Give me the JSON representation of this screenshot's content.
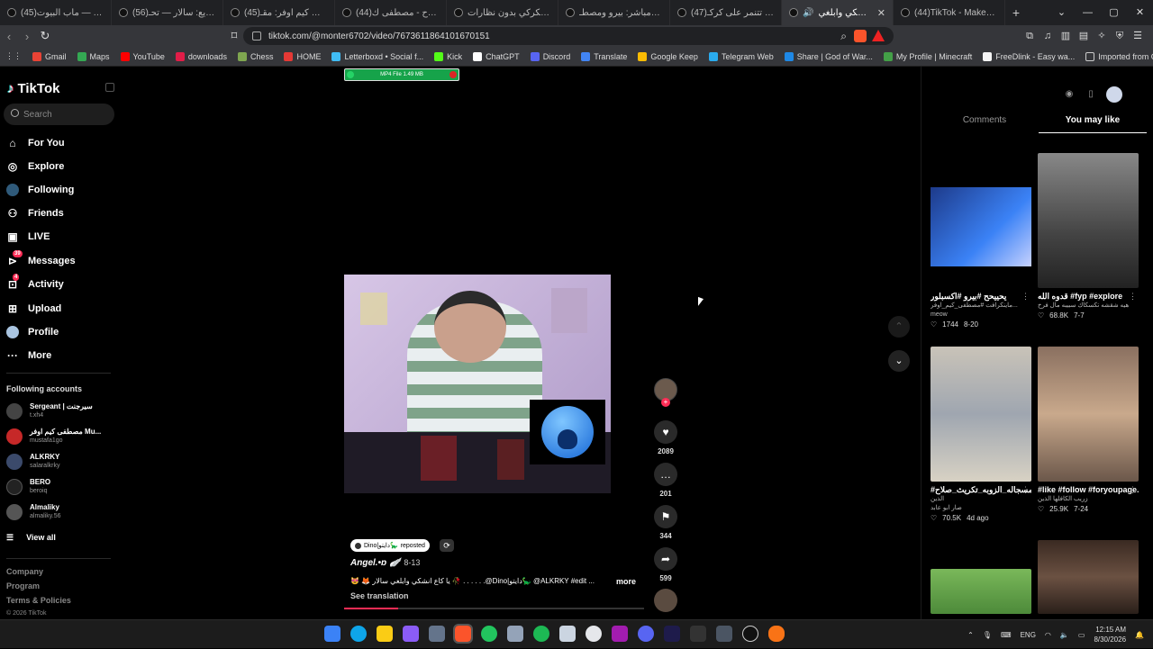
{
  "browser": {
    "tabs": [
      {
        "title": "(45)نص قلب — ماب البيوت"
      },
      {
        "title": "(56)كور سريع: سالار — تحـ"
      },
      {
        "title": "(45)مصطفى كيم اوفر: مقـ"
      },
      {
        "title": "(44)بحث ارتاح - مصطفى ك"
      },
      {
        "title": "سالار الكركي بدون نظارات"
      },
      {
        "title": "بث بيرو مباشر: بيرو ومصطـ"
      },
      {
        "title": "(47)ديرياتك تتنمر على كركـ"
      },
      {
        "title": "يا كاع انشكي وابلغي",
        "active": true
      },
      {
        "title": "(44)TikTok - Make Your D"
      }
    ],
    "new_tab": "+",
    "window_controls": {
      "minimize": "—",
      "maximize": "▢",
      "close": "✕",
      "chevron": "⌄"
    },
    "url": "tiktok.com/@monter6702/video/7673611864101670151",
    "bookmarks": [
      {
        "label": "Gmail",
        "color": "#ea4335"
      },
      {
        "label": "Maps",
        "color": "#34a853"
      },
      {
        "label": "YouTube",
        "color": "#ff0000"
      },
      {
        "label": "downloads",
        "color": "#e11d48"
      },
      {
        "label": "Chess",
        "color": "#7fa650"
      },
      {
        "label": "HOME",
        "color": "#e53935"
      },
      {
        "label": "Letterboxd • Social f...",
        "color": "#40bcf4"
      },
      {
        "label": "Kick",
        "color": "#53fc18"
      },
      {
        "label": "ChatGPT",
        "color": "#ffffff"
      },
      {
        "label": "Discord",
        "color": "#5865f2"
      },
      {
        "label": "Translate",
        "color": "#4285f4"
      },
      {
        "label": "Google Keep",
        "color": "#fbbc04"
      },
      {
        "label": "Telegram Web",
        "color": "#2aabee"
      },
      {
        "label": "Share | God of War...",
        "color": "#1e88e5"
      },
      {
        "label": "My Profile | Minecraft",
        "color": "#43a047"
      },
      {
        "label": "FreeDlink - Easy wa...",
        "color": "#f5f5f5"
      }
    ],
    "bookmarks_folder": "Imported from Go..."
  },
  "tiktok": {
    "logo": "TikTok",
    "search_placeholder": "Search",
    "nav": [
      {
        "label": "For You",
        "icon": "home-icon"
      },
      {
        "label": "Explore",
        "icon": "compass-icon"
      },
      {
        "label": "Following",
        "icon": "following-icon"
      },
      {
        "label": "Friends",
        "icon": "friends-icon"
      },
      {
        "label": "LIVE",
        "icon": "live-icon"
      },
      {
        "label": "Messages",
        "icon": "messages-icon",
        "badge": "39"
      },
      {
        "label": "Activity",
        "icon": "activity-icon",
        "badge": "4"
      },
      {
        "label": "Upload",
        "icon": "upload-icon"
      },
      {
        "label": "Profile",
        "icon": "profile-icon"
      },
      {
        "label": "More",
        "icon": "more-icon"
      }
    ],
    "following_heading": "Following accounts",
    "following": [
      {
        "name": "Sergeant | سيرجنت",
        "handle": "t.xh4"
      },
      {
        "name": "مصطفى كيم اوفر Mu...",
        "handle": "mustafa1go"
      },
      {
        "name": "ALKRKY",
        "handle": "salaralkrky"
      },
      {
        "name": "BERO",
        "handle": "beroiq"
      },
      {
        "name": "Almaliky",
        "handle": "almaliky.56"
      }
    ],
    "view_all": "View all",
    "footer": {
      "company": "Company",
      "program": "Program",
      "terms": "Terms & Policies",
      "copyright": "© 2026 TikTok"
    },
    "download_bar": "MP4 File 1.49 MB",
    "video": {
      "repost_author": "Dino|دايتو🦕",
      "repost_label": "reposted",
      "author": "Angel.•ɒ 🪽",
      "date": "8-13",
      "description": "😻 🦊 يا كاع انشكي وابلغي سالار 🥀 . . . . . .@Dino|دايتو🦕 @ALKRKY #edit ...",
      "more": "more",
      "see_translation": "See translation",
      "progress": 0.18,
      "likes": "2089",
      "comments": "201",
      "saves": "344",
      "shares": "599"
    },
    "right_panel": {
      "tabs": [
        {
          "label": "Comments"
        },
        {
          "label": "You may like",
          "active": true
        }
      ],
      "cards": [
        {
          "title": "يحييحح #بيرو #اكسبلور",
          "sub": "ماينكرافت #مصطفى_كيم_اوفر...",
          "sub2": "meow",
          "likes": "1744",
          "date": "8-20"
        },
        {
          "title": "قدوه الله #fyp #explore",
          "sub": "هيه شقشه تكسكاك سبيبه مال فرخ",
          "sub2": "",
          "likes": "68.8K",
          "date": "7-7"
        },
        {
          "title": "#المسجاله_الزوبه_تكريث_صلاح_...",
          "sub": "الذين",
          "sub2": "صار ابو عابد",
          "likes": "70.5K",
          "date": "4d ago"
        },
        {
          "title": "#like #follow #foryoupage...",
          "sub": "زريب الكافلها الذين",
          "sub2": "",
          "likes": "25.9K",
          "date": "7-24"
        }
      ]
    }
  },
  "taskbar": {
    "lang": "ENG",
    "time": "12:15 AM",
    "date": "8/30/2026"
  }
}
